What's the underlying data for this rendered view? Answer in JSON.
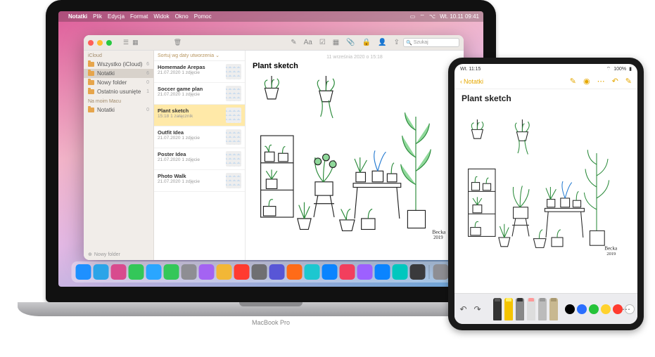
{
  "mac": {
    "menubar": {
      "app": "Notatki",
      "items": [
        "Plik",
        "Edycja",
        "Format",
        "Widok",
        "Okno",
        "Pomoc"
      ],
      "clock": "Wt. 10.11  09:41"
    },
    "window": {
      "search_placeholder": "Szukaj",
      "sidebar": {
        "section1": "iCloud",
        "items1": [
          {
            "label": "Wszystko (iCloud)",
            "count": "6"
          },
          {
            "label": "Notatki",
            "count": "6",
            "selected": true
          },
          {
            "label": "Nowy folder",
            "count": "0"
          },
          {
            "label": "Ostatnio usunięte",
            "count": "1"
          }
        ],
        "section2": "Na moim Macu",
        "items2": [
          {
            "label": "Notatki",
            "count": "0"
          }
        ],
        "new_folder": "Nowy folder"
      },
      "sort_label": "Sortuj wg daty utworzenia",
      "notes": [
        {
          "title": "Homemade Arepas",
          "sub": "21.07.2020   1 zdjęcie"
        },
        {
          "title": "Soccer game plan",
          "sub": "21.07.2020   1 zdjęcie"
        },
        {
          "title": "Plant sketch",
          "sub": "15:18   1 załącznik",
          "selected": true
        },
        {
          "title": "Outfit Idea",
          "sub": "21.07.2020   1 zdjęcie"
        },
        {
          "title": "Poster Idea",
          "sub": "21.07.2020   1 zdjęcie"
        },
        {
          "title": "Photo Walk",
          "sub": "21.07.2020   1 zdjęcie"
        }
      ],
      "content": {
        "date": "11 września 2020 o 15:18",
        "title": "Plant sketch",
        "signature": "Becka 2019"
      }
    },
    "device_label": "MacBook Pro",
    "dock_colors": [
      "#1e90ff",
      "#2ca4e8",
      "#d84b8e",
      "#33c759",
      "#2aa6ff",
      "#34c759",
      "#8e8e93",
      "#a463f2",
      "#f2b736",
      "#ff3b30",
      "#6f6f72",
      "#5856d6",
      "#ff6b18",
      "#1cc7d0",
      "#0a84ff",
      "#f23f5d",
      "#9d60ff",
      "#0a84ff",
      "#00c7be",
      "#3a3a3c",
      "#8e8e93",
      "#5ac8fa"
    ]
  },
  "ipad": {
    "status": {
      "time": "Wt. 11:15",
      "battery": "100%"
    },
    "back_label": "Notatki",
    "title": "Plant sketch",
    "signature": "Becka 2019"
  }
}
